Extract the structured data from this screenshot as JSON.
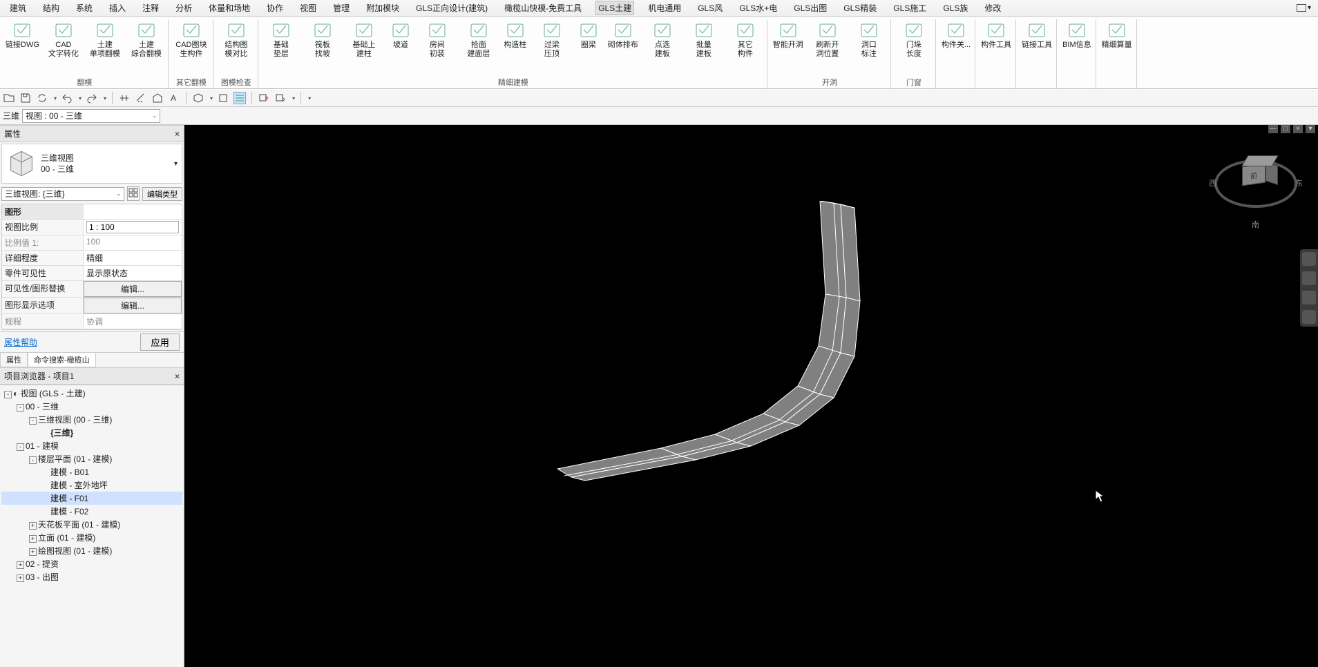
{
  "menubar": [
    "建筑",
    "结构",
    "系统",
    "插入",
    "注释",
    "分析",
    "体量和场地",
    "协作",
    "视图",
    "管理",
    "附加模块",
    "GLS正向设计(建筑)",
    "橄榄山快模-免费工具",
    "GLS土建",
    "机电通用",
    "GLS风",
    "GLS水+电",
    "GLS出图",
    "GLS精装",
    "GLS施工",
    "GLS族",
    "修改"
  ],
  "menubar_active_index": 13,
  "ribbon_groups": [
    {
      "label": "翻模",
      "items": [
        [
          "链接DWG"
        ],
        [
          "CAD",
          "文字转化"
        ],
        [
          "土建",
          "单项翻模"
        ],
        [
          "土建",
          "综合翻模"
        ]
      ]
    },
    {
      "label": "其它翻模",
      "items": [
        [
          "CAD图块",
          "生构件"
        ]
      ]
    },
    {
      "label": "图模检查",
      "items": [
        [
          "结构图",
          "模对比"
        ]
      ]
    },
    {
      "label": "精细建模",
      "items": [
        [
          "基础",
          "垫层"
        ],
        [
          "筏板",
          "找坡"
        ],
        [
          "基础上",
          "建柱"
        ],
        [
          "坡道"
        ],
        [
          "房间",
          "初装"
        ],
        [
          "拾面",
          "建面层"
        ],
        [
          "构造柱"
        ],
        [
          "过梁",
          "压顶"
        ],
        [
          "圈梁"
        ],
        [
          "砌体排布"
        ],
        [
          "点选",
          "建板"
        ],
        [
          "批量",
          "建板"
        ],
        [
          "其它",
          "构件"
        ]
      ]
    },
    {
      "label": "开洞",
      "items": [
        [
          "智能开洞"
        ],
        [
          "刷新开",
          "洞位置"
        ],
        [
          "洞口",
          "标注"
        ]
      ]
    },
    {
      "label": "门窗",
      "items": [
        [
          "门垛",
          "长度"
        ]
      ]
    },
    {
      "label": "",
      "items": [
        [
          "构件关..."
        ]
      ]
    },
    {
      "label": "",
      "items": [
        [
          "构件工具"
        ]
      ]
    },
    {
      "label": "",
      "items": [
        [
          "链接工具"
        ]
      ]
    },
    {
      "label": "",
      "items": [
        [
          "BIM信息"
        ]
      ]
    },
    {
      "label": "",
      "items": [
        [
          "精细算量"
        ]
      ]
    }
  ],
  "selector": {
    "label": "三维",
    "combo": "视图 : 00 - 三维"
  },
  "properties": {
    "title": "属性",
    "type_line1": "三维视图",
    "type_line2": "00 - 三维",
    "instance_combo": "三维视图: {三维}",
    "edit_type_btn": "编辑类型",
    "section": "图形",
    "rows": [
      {
        "k": "视图比例",
        "v": "1 : 100",
        "input": true
      },
      {
        "k": "比例值 1:",
        "v": "100",
        "gray": true
      },
      {
        "k": "详细程度",
        "v": "精细"
      },
      {
        "k": "零件可见性",
        "v": "显示原状态"
      },
      {
        "k": "可见性/图形替换",
        "v": "编辑...",
        "btn": true
      },
      {
        "k": "图形显示选项",
        "v": "编辑...",
        "btn": true
      },
      {
        "k": "规程",
        "v": "协调",
        "gray": true
      }
    ],
    "help_link": "属性帮助",
    "apply_btn": "应用",
    "tabs": [
      "属性",
      "命令搜索-橄榄山"
    ]
  },
  "browser": {
    "title": "项目浏览器 - 项目1",
    "tree": [
      {
        "d": 0,
        "exp": "-",
        "lbl": "视图 (GLS - 土建)",
        "ic": "c"
      },
      {
        "d": 1,
        "exp": "-",
        "lbl": "00 - 三维"
      },
      {
        "d": 2,
        "exp": "-",
        "lbl": "三维视图 (00 - 三维)"
      },
      {
        "d": 3,
        "lbl": "{三维}",
        "bold": true
      },
      {
        "d": 1,
        "exp": "-",
        "lbl": "01 - 建模"
      },
      {
        "d": 2,
        "exp": "-",
        "lbl": "楼层平面 (01 - 建模)"
      },
      {
        "d": 3,
        "lbl": "建模 - B01"
      },
      {
        "d": 3,
        "lbl": "建模 - 室外地坪"
      },
      {
        "d": 3,
        "lbl": "建模 - F01",
        "sel": true
      },
      {
        "d": 3,
        "lbl": "建模 - F02"
      },
      {
        "d": 2,
        "exp": "+",
        "lbl": "天花板平面 (01 - 建模)"
      },
      {
        "d": 2,
        "exp": "+",
        "lbl": "立面 (01 - 建模)"
      },
      {
        "d": 2,
        "exp": "+",
        "lbl": "绘图视图 (01 - 建模)"
      },
      {
        "d": 1,
        "exp": "+",
        "lbl": "02 - 提资"
      },
      {
        "d": 1,
        "exp": "+",
        "lbl": "03 - 出图"
      }
    ]
  },
  "viewcube": {
    "front": "前",
    "s": "南",
    "e": "东",
    "w": "西"
  }
}
